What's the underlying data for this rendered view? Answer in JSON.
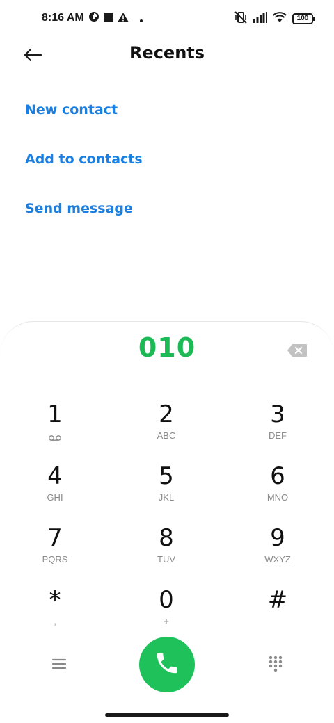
{
  "status_bar": {
    "time": "8:16 AM",
    "battery": "100",
    "icons": [
      "media-icon",
      "square-notification-icon",
      "warning-icon",
      "dot-icon",
      "vibrate-off-icon",
      "signal-icon",
      "wifi-icon",
      "battery-icon"
    ]
  },
  "header": {
    "title": "Recents",
    "back_icon": "back-arrow-icon"
  },
  "actions": {
    "new_contact": "New contact",
    "add_to_contacts": "Add to contacts",
    "send_message": "Send message"
  },
  "dialer": {
    "number": "010",
    "backspace_icon": "backspace-icon",
    "keys": [
      {
        "digit": "1",
        "letters": "",
        "icon": "voicemail-icon"
      },
      {
        "digit": "2",
        "letters": "ABC"
      },
      {
        "digit": "3",
        "letters": "DEF"
      },
      {
        "digit": "4",
        "letters": "GHI"
      },
      {
        "digit": "5",
        "letters": "JKL"
      },
      {
        "digit": "6",
        "letters": "MNO"
      },
      {
        "digit": "7",
        "letters": "PQRS"
      },
      {
        "digit": "8",
        "letters": "TUV"
      },
      {
        "digit": "9",
        "letters": "WXYZ"
      },
      {
        "digit": "*",
        "letters": ","
      },
      {
        "digit": "0",
        "letters": "+"
      },
      {
        "digit": "#",
        "letters": ""
      }
    ],
    "bottom_icons": [
      "menu-icon",
      "phone-icon",
      "keypad-icon"
    ]
  },
  "colors": {
    "accent_blue": "#1a7fe0",
    "dial_green": "#1db955",
    "call_green": "#1fc15a"
  }
}
